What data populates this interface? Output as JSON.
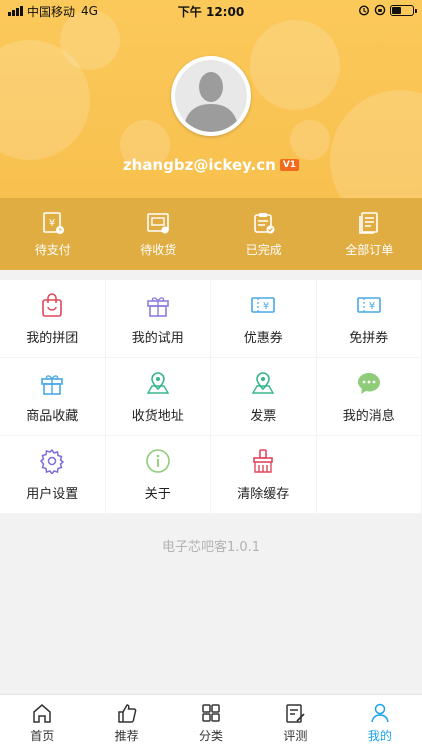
{
  "status_bar": {
    "carrier": "中国移动",
    "network": "4G",
    "time": "下午 12:00"
  },
  "profile": {
    "email": "zhangbz@ickey.cn",
    "level": "V1"
  },
  "orders": [
    {
      "label": "待支付",
      "icon": "payment-icon"
    },
    {
      "label": "待收货",
      "icon": "receive-icon"
    },
    {
      "label": "已完成",
      "icon": "completed-icon"
    },
    {
      "label": "全部订单",
      "icon": "all-orders-icon"
    }
  ],
  "menu": [
    {
      "label": "我的拼团",
      "icon": "shopping-bag-icon",
      "color": "#e0475b"
    },
    {
      "label": "我的试用",
      "icon": "gift-icon",
      "color": "#8a7ee0"
    },
    {
      "label": "优惠券",
      "icon": "coupon-icon",
      "color": "#4aa8e6"
    },
    {
      "label": "免拼券",
      "icon": "coupon-icon",
      "color": "#4aa8e6"
    },
    {
      "label": "商品收藏",
      "icon": "gift-box-icon",
      "color": "#4aa8e6"
    },
    {
      "label": "收货地址",
      "icon": "map-pin-icon",
      "color": "#36b58c"
    },
    {
      "label": "发票",
      "icon": "map-pin-icon",
      "color": "#36b58c"
    },
    {
      "label": "我的消息",
      "icon": "chat-icon",
      "color": "#8fcc7a"
    },
    {
      "label": "用户设置",
      "icon": "gear-icon",
      "color": "#7a6ee0"
    },
    {
      "label": "关于",
      "icon": "info-icon",
      "color": "#8fcc7a"
    },
    {
      "label": "清除缓存",
      "icon": "broom-icon",
      "color": "#e0475b"
    }
  ],
  "app_version": "电子芯吧客1.0.1",
  "tabs": [
    {
      "label": "首页",
      "icon": "home-icon",
      "active": false
    },
    {
      "label": "推荐",
      "icon": "thumbs-up-icon",
      "active": false
    },
    {
      "label": "分类",
      "icon": "category-grid-icon",
      "active": false
    },
    {
      "label": "评测",
      "icon": "review-icon",
      "active": false
    },
    {
      "label": "我的",
      "icon": "user-icon",
      "active": true
    }
  ],
  "colors": {
    "header": "#f7bd4a",
    "order_bar": "#e0ad42",
    "active_tab": "#1aa2f0",
    "vip_badge": "#f26a1b"
  }
}
